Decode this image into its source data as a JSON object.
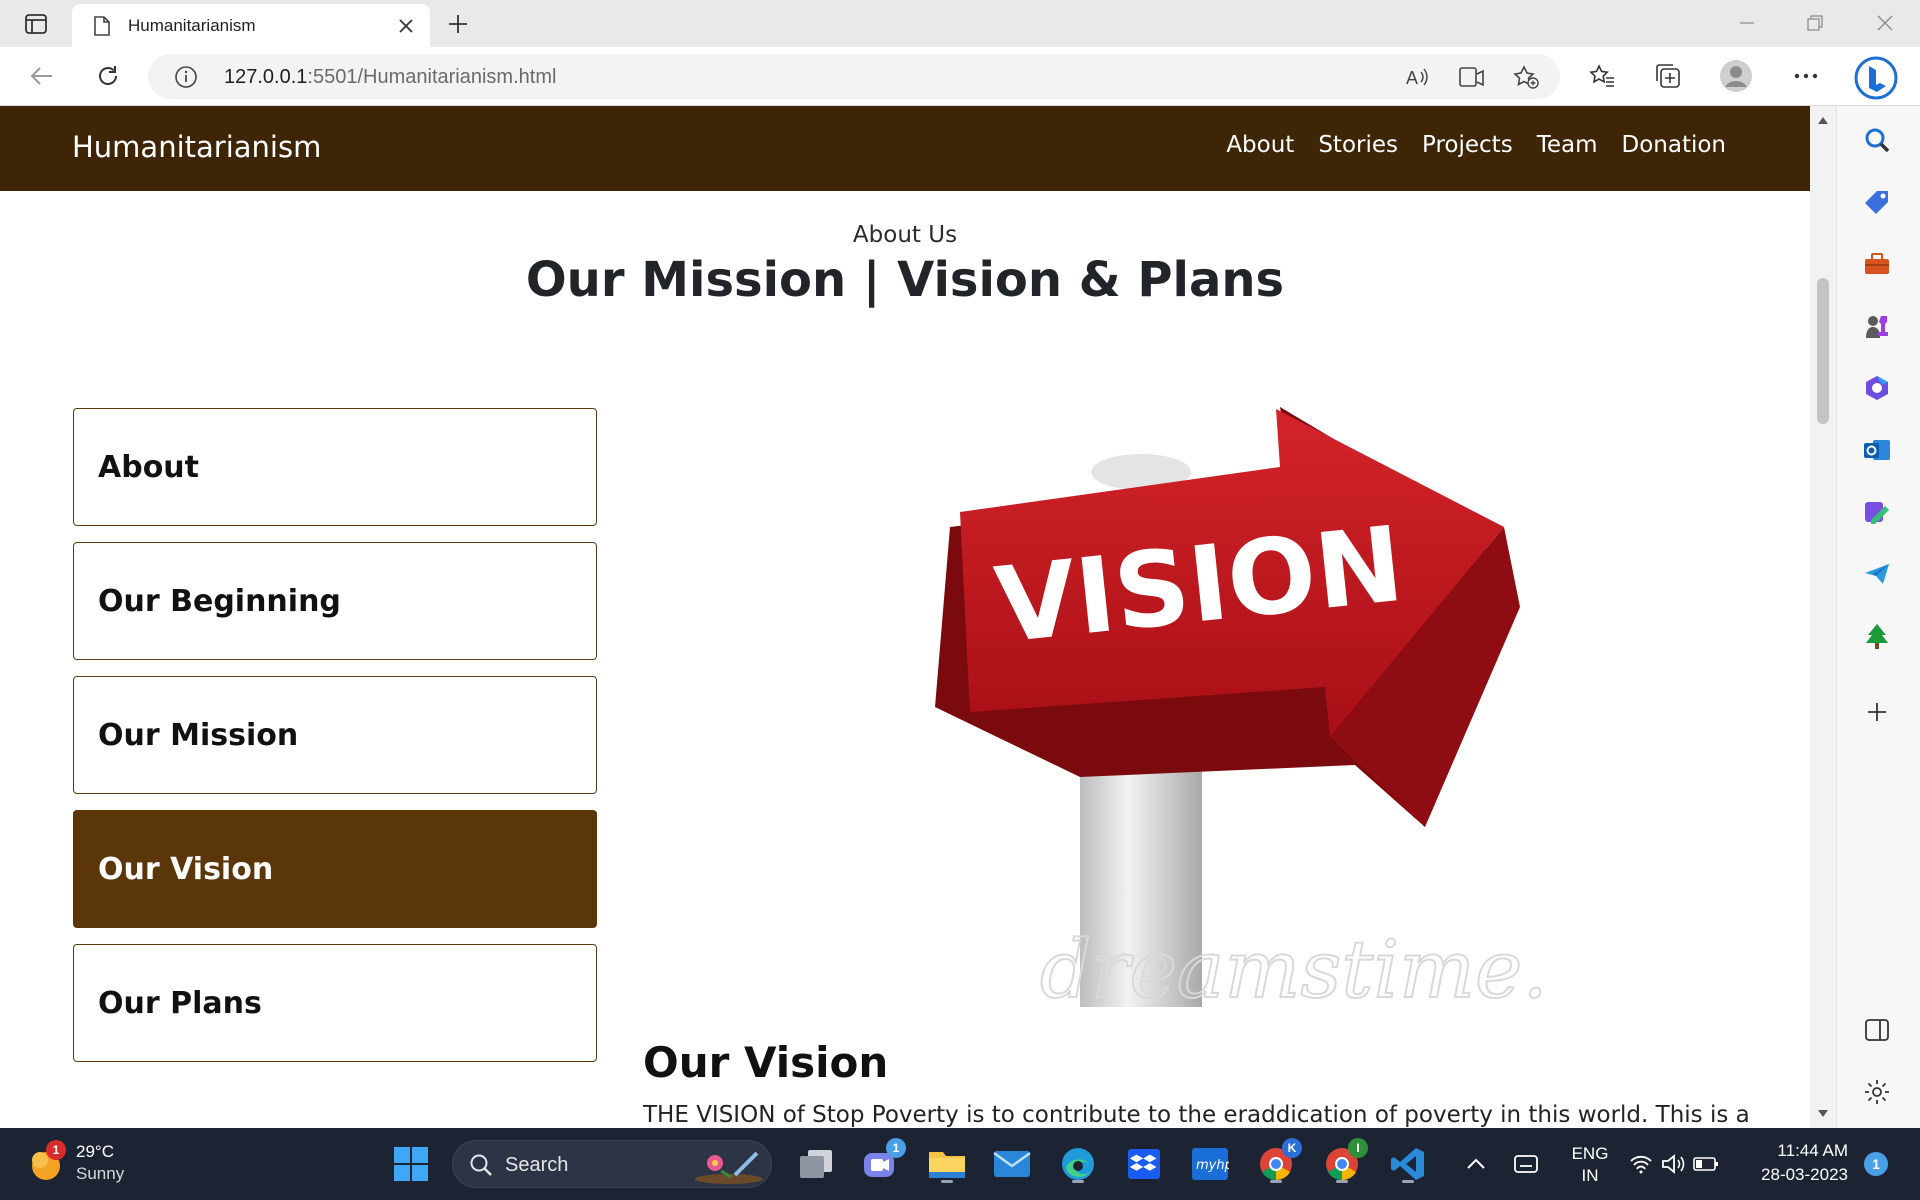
{
  "browser": {
    "tab_title": "Humanitarianism",
    "url_host": "127.0.0.1",
    "url_rest": ":5501/Humanitarianism.html"
  },
  "site": {
    "brand": "Humanitarianism",
    "nav": [
      "About",
      "Stories",
      "Projects",
      "Team",
      "Donation"
    ]
  },
  "hero": {
    "eyebrow": "About Us",
    "title": "Our Mission | Vision & Plans"
  },
  "side_menu": {
    "items": [
      "About",
      "Our Beginning",
      "Our Mission",
      "Our Vision",
      "Our Plans"
    ],
    "active": "Our Vision"
  },
  "image": {
    "sign_text": "VISION",
    "watermark": "dreamstime."
  },
  "section": {
    "heading": "Our Vision",
    "paragraph": "THE VISION of Stop Poverty is to contribute to the eraddication of poverty in this world. This is a"
  },
  "taskbar": {
    "weather_temp": "29°C",
    "weather_cond": "Sunny",
    "weather_badge": "1",
    "search_label": "Search",
    "teams_badge": "1",
    "lang_top": "ENG",
    "lang_bottom": "IN",
    "time": "11:44 AM",
    "date": "28-03-2023",
    "notif_count": "1"
  },
  "colors": {
    "navbar": "#3d2505",
    "active_menu": "#5a3609",
    "sign_red": "#c0161c"
  }
}
